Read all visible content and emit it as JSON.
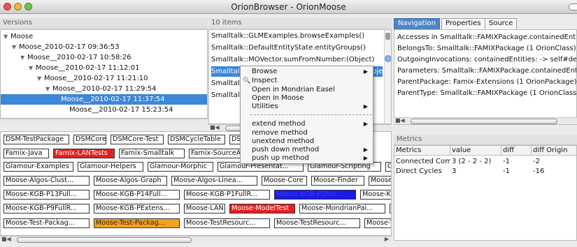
{
  "window": {
    "title": "OrionBrowser - OrionMoose"
  },
  "versions": {
    "header": "Versions",
    "rows": [
      {
        "label": "Moose",
        "expanded": true,
        "selected": false
      },
      {
        "label": "Moose_2010-02-17 09:36:53",
        "expanded": true,
        "selected": false
      },
      {
        "label": "Moose__2010-02-17 10:58:26",
        "expanded": true,
        "selected": false
      },
      {
        "label": "Moose__2010-02-17 11:12:01",
        "expanded": true,
        "selected": false
      },
      {
        "label": "Moose__2010-02-17 11:21:10",
        "expanded": true,
        "selected": false
      },
      {
        "label": "Moose__2010-02-17 11:29:54",
        "expanded": true,
        "selected": false
      },
      {
        "label": "Moose__2010-02-17 11:37:54",
        "expanded": false,
        "selected": true
      },
      {
        "label": "Moose__2010-02-17 15:23:54",
        "expanded": false,
        "selected": false
      }
    ]
  },
  "items": {
    "header": "10 items",
    "rows": [
      {
        "label": "Smalltalk::GLMExamples.browseExamples()",
        "selected": false
      },
      {
        "label": "Smalltalk::DefaultEntityState.entityGroups()",
        "selected": false
      },
      {
        "label": "Smalltalk::MOVector.sumFromNumber:(Object)",
        "selected": false
      },
      {
        "label": "Smalltalk::FAMIXPackage.containedEntities:(Objec",
        "selected": true
      },
      {
        "label": "Smalltalk::FAMIXPackage.outgoingInvocations:",
        "selected": false
      },
      {
        "label": "Smalltalk::FAMIXPackage.parentType:(Ob",
        "selected": false
      }
    ]
  },
  "tabs": [
    "Navigation",
    "Properties",
    "Source"
  ],
  "navigation": {
    "lines": [
      "Accesses in Smalltalk::FAMIXPackage.containedEntities:",
      "BelongsTo: Smalltalk::FAMIXPackage (1 OrionClass)",
      "OutgoingInvocations: containedEntities: -> self#definedEnt",
      "Parameters: Smalltalk::FAMIXPackage.containedEntities:",
      "ParentPackage: Famix-Extensions (1 OrionPackage)",
      "ParentType: Smalltalk::FAMIXPackage (1 OrionClass)"
    ]
  },
  "context_menu": {
    "items": [
      {
        "label": "Browse",
        "submenu": true,
        "icon": ""
      },
      {
        "label": "Inspect",
        "submenu": false,
        "icon": "magnifier-icon"
      },
      {
        "label": "Open in Mondrian Easel",
        "submenu": false,
        "icon": ""
      },
      {
        "label": "Open in Moose",
        "submenu": false,
        "icon": ""
      },
      {
        "label": "Utilities",
        "submenu": true,
        "icon": ""
      }
    ],
    "items2": [
      {
        "label": "extend method",
        "submenu": true
      },
      {
        "label": "remove method",
        "submenu": false
      },
      {
        "label": "unextend method",
        "submenu": false
      },
      {
        "label": "push down method",
        "submenu": true
      },
      {
        "label": "push up method",
        "submenu": true
      }
    ]
  },
  "packages": {
    "rows": [
      [
        {
          "label": "DSM-TestPackage",
          "color": "white"
        },
        {
          "label": "DSMCore",
          "color": "white"
        },
        {
          "label": "DSMCore-Test",
          "color": "white"
        },
        {
          "label": "DSMCycleTable",
          "color": "white"
        },
        {
          "label": "DSM",
          "color": "white"
        },
        {
          "label": "x-Ex",
          "color": "white"
        }
      ],
      [
        {
          "label": "Famix-Java",
          "color": "white"
        },
        {
          "label": "Famix-LANTests",
          "color": "red"
        },
        {
          "label": "Famix-Smalltalk",
          "color": "white"
        },
        {
          "label": "Famix-SourceAnch",
          "color": "white"
        },
        {
          "label": "Core",
          "color": "white"
        }
      ],
      [
        {
          "label": "Glamour-Examples",
          "color": "white"
        },
        {
          "label": "Glamour-Helpers",
          "color": "white"
        },
        {
          "label": "Glamour-Morphic",
          "color": "white"
        },
        {
          "label": "Glamour-Presentat...",
          "color": "white"
        },
        {
          "label": "Glamour-Scripting",
          "color": "white"
        },
        {
          "label": "Glamour",
          "color": "white"
        }
      ],
      [
        {
          "label": "Moose-Algos-Clust...",
          "color": "white"
        },
        {
          "label": "Moose-Algos-Graph",
          "color": "white"
        },
        {
          "label": "Moose-Algos-Linea...",
          "color": "white"
        },
        {
          "label": "Moose-Core",
          "color": "white"
        },
        {
          "label": "Moose-Finder",
          "color": "white"
        },
        {
          "label": "Moose-Generic",
          "color": "white"
        }
      ],
      [
        {
          "label": "Moose-KGB-P13Full...",
          "color": "white"
        },
        {
          "label": "Moose-KGB-P14Full...",
          "color": "white"
        },
        {
          "label": "Moose-KGB-P1FullR...",
          "color": "white"
        },
        {
          "label": "Moose-KGB-P2Full...",
          "color": "blue"
        },
        {
          "label": "Moose-KGB-P3Inte",
          "color": "white"
        }
      ],
      [
        {
          "label": "Moose-KGB-P9FullR...",
          "color": "white"
        },
        {
          "label": "Moose-KGB-PExtens...",
          "color": "white"
        },
        {
          "label": "Moose-LAN",
          "color": "white"
        },
        {
          "label": "Moose-ModelTest",
          "color": "red"
        },
        {
          "label": "Moose-MondrianPai...",
          "color": "white"
        },
        {
          "label": "Moose-M",
          "color": "white"
        }
      ],
      [
        {
          "label": "Moose-Test-Packag...",
          "color": "white"
        },
        {
          "label": "Moose-Test-Packag...",
          "color": "orange"
        },
        {
          "label": "Moose-TestResourc...",
          "color": "white"
        },
        {
          "label": "Moose-TestResourc...",
          "color": "white"
        },
        {
          "label": "Moose-TestResourc...",
          "color": "white"
        }
      ]
    ]
  },
  "metrics": {
    "header": "Metrics",
    "columns": [
      "Metrics",
      "value",
      "diff",
      "diff Origin"
    ],
    "rows": [
      [
        "Connected Com",
        "3 (2 - 2 - 2)",
        "-1",
        "-2"
      ],
      [
        "Direct Cycles",
        "3",
        "-1",
        "-16"
      ]
    ]
  },
  "colors": {
    "selection": "#3d86d8",
    "red": "#e51f1f",
    "blue": "#1a1ae6",
    "orange": "#f4a11f"
  }
}
